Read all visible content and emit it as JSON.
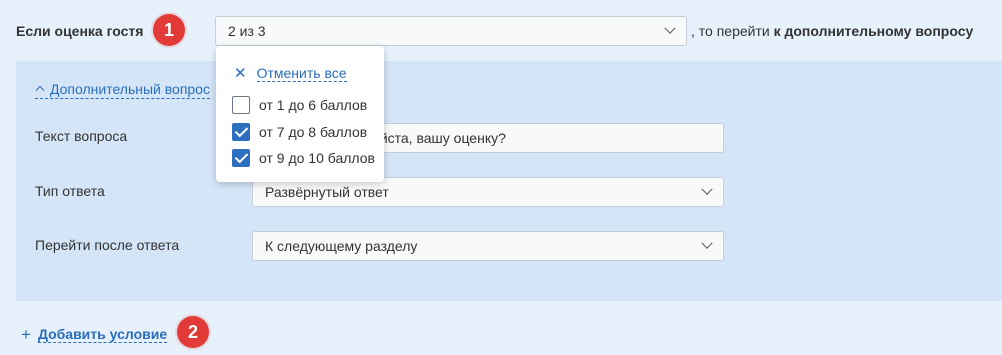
{
  "condition": {
    "label": "Если оценка гостя",
    "badge": "1",
    "score_select_value": "2 из 3",
    "then_prefix": ", то перейти",
    "then_target": "к дополнительному вопросу"
  },
  "dropdown": {
    "cancel_label": "Отменить все",
    "options": [
      {
        "label": "от 1 до 6 баллов",
        "checked": false
      },
      {
        "label": "от 7 до 8 баллов",
        "checked": true
      },
      {
        "label": "от 9 до 10 баллов",
        "checked": true
      }
    ]
  },
  "extra_question": {
    "toggle_label": "Дополнительный вопрос",
    "text_label": "Текст вопроса",
    "text_value": "Уточните, пожалуйста, вашу оценку?",
    "answer_type_label": "Тип ответа",
    "answer_type_value": "Развёрнутый ответ",
    "goto_label": "Перейти после ответа",
    "goto_value": "К следующему разделу"
  },
  "add_condition": {
    "label": "Добавить условие",
    "badge": "2"
  },
  "colors": {
    "background": "#e7f1fc",
    "panel": "#d4e5f7",
    "link": "#2a6ebb",
    "badge": "#e23a37",
    "checkbox_checked": "#2e6fc0"
  }
}
